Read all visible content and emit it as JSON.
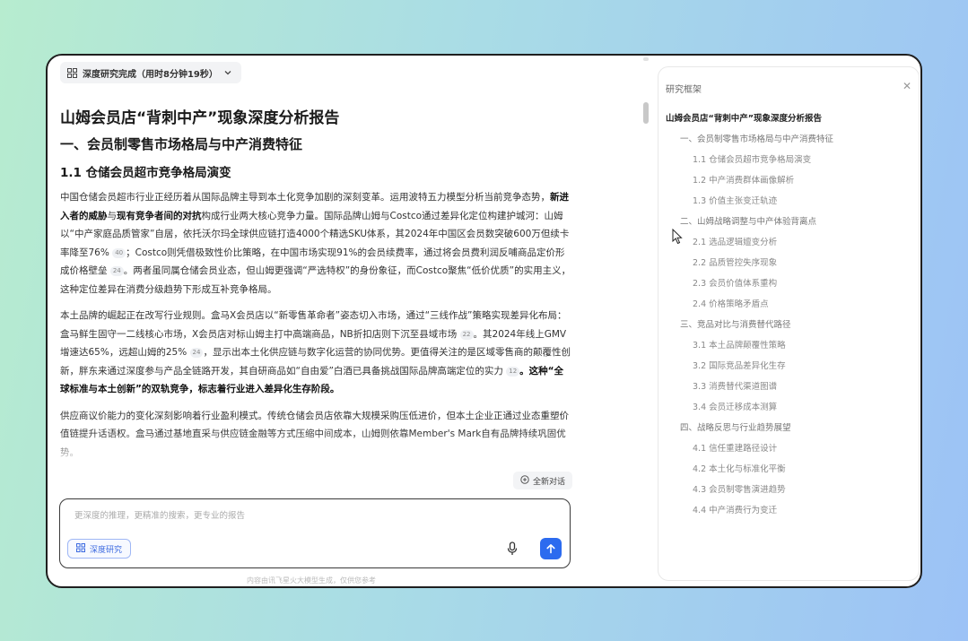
{
  "header": {
    "status": "深度研究完成（用时8分钟19秒）"
  },
  "report": {
    "title": "山姆会员店“背刺中产”现象深度分析报告",
    "section": "一、会员制零售市场格局与中产消费特征",
    "subsection": "1.1 仓储会员超市竞争格局演变",
    "p1": {
      "a": "中国仓储会员超市行业正经历着从国际品牌主导到本土化竞争加剧的深刻变革。运用波特五力模型分析当前竞争态势，",
      "b": "新进入者的威胁",
      "c": "与",
      "d": "现有竞争者间的对抗",
      "e": "构成行业两大核心竞争力量。国际品牌山姆与Costco通过差异化定位构建护城河：山姆以“中产家庭品质管家”自居，依托沃尔玛全球供应链打造4000个精选SKU体系，其2024年中国区会员数突破600万但续卡率降至76%",
      "c1": "40",
      "f": "；Costco则凭借极致性价比策略，在中国市场实现91%的会员续费率，通过将会员费利润反哺商品定价形成价格壁垒",
      "c2": "24",
      "g": "。两者虽同属仓储会员业态，但山姆更强调“严选特权”的身份象征，而Costco聚焦“低价优质”的实用主义，这种定位差异在消费分级趋势下形成互补竞争格局。"
    },
    "p2": {
      "a": "本土品牌的崛起正在改写行业规则。盒马X会员店以“新零售革命者”姿态切入市场，通过“三线作战”策略实现差异化布局：盒马鲜生固守一二线核心市场，X会员店对标山姆主打中高端商品，NB折扣店则下沉至县域市场",
      "c1": "22",
      "b": "。其2024年线上GMV增速达65%，远超山姆的25%",
      "c2": "24",
      "c": "，显示出本土化供应链与数字化运营的协同优势。更值得关注的是区域零售商的颠覆性创新，胖东来通过深度参与产品全链路开发，其自研商品如“自由爱”白酒已具备挑战国际品牌高端定位的实力",
      "c3": "12",
      "d": "。这种“全球标准与本土创新”的双轨竞争，标志着行业进入差异化生存阶段。"
    },
    "p3": "供应商议价能力的变化深刻影响着行业盈利模式。传统仓储会员店依靠大规模采购压低进价，但本土企业正通过业态重塑价值链提升话语权。盒马通过基地直采与供应链金融等方式压缩中间成本，山姆则依靠Member's Mark自有品牌持续巩固优势。"
  },
  "actions": {
    "new_chat": "全新对话"
  },
  "input": {
    "placeholder": "更深度的推理，更精准的搜索，更专业的报告",
    "deep_research": "深度研究"
  },
  "footer": "内容由讯飞星火大模型生成，仅供您参考",
  "panel": {
    "title": "研究框架",
    "outline": [
      {
        "level": 0,
        "label": "山姆会员店“背刺中产”现象深度分析报告"
      },
      {
        "level": 1,
        "label": "一、会员制零售市场格局与中产消费特征"
      },
      {
        "level": 2,
        "label": "1.1 仓储会员超市竞争格局演变"
      },
      {
        "level": 2,
        "label": "1.2 中产消费群体画像解析"
      },
      {
        "level": 2,
        "label": "1.3 价值主张变迁轨迹"
      },
      {
        "level": 1,
        "label": "二、山姆战略调整与中产体验背离点"
      },
      {
        "level": 2,
        "label": "2.1 选品逻辑嬗变分析"
      },
      {
        "level": 2,
        "label": "2.2 品质管控失序现象"
      },
      {
        "level": 2,
        "label": "2.3 会员价值体系重构"
      },
      {
        "level": 2,
        "label": "2.4 价格策略矛盾点"
      },
      {
        "level": 1,
        "label": "三、竞品对比与消费替代路径"
      },
      {
        "level": 2,
        "label": "3.1 本土品牌颠覆性策略"
      },
      {
        "level": 2,
        "label": "3.2 国际竞品差异化生存"
      },
      {
        "level": 2,
        "label": "3.3 消费替代渠道图谱"
      },
      {
        "level": 2,
        "label": "3.4 会员迁移成本测算"
      },
      {
        "level": 1,
        "label": "四、战略反思与行业趋势展望"
      },
      {
        "level": 2,
        "label": "4.1 信任重建路径设计"
      },
      {
        "level": 2,
        "label": "4.2 本土化与标准化平衡"
      },
      {
        "level": 2,
        "label": "4.3 会员制零售演进趋势"
      },
      {
        "level": 2,
        "label": "4.4 中产消费行为变迁"
      }
    ]
  }
}
